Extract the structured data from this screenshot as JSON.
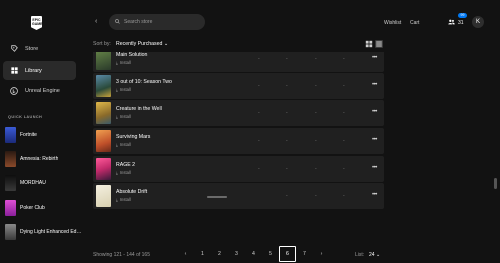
{
  "logo": {
    "text": "EPIC\nGAMES"
  },
  "sidebar": {
    "nav": [
      {
        "label": "Store",
        "icon": "tag-icon",
        "active": false
      },
      {
        "label": "Library",
        "icon": "grid-icon",
        "active": true
      },
      {
        "label": "Unreal Engine",
        "icon": "unreal-icon",
        "active": false
      }
    ],
    "quick_launch_title": "QUICK LAUNCH",
    "quick_launch": [
      {
        "label": "Fortnite",
        "color": "#3b5bd6"
      },
      {
        "label": "Amnesia: Rebirth",
        "color": "#6a3b2a"
      },
      {
        "label": "MORDHAU",
        "color": "#1c1c1c"
      },
      {
        "label": "Poker Club",
        "color": "#d63bd1"
      },
      {
        "label": "Dying Light Enhanced Edition",
        "color": "#6e6e6e"
      }
    ]
  },
  "topbar": {
    "search_placeholder": "Search store",
    "wishlist": "Wishlist",
    "cart": "Cart",
    "friends_count": "31",
    "friends_badge": "99",
    "avatar_initial": "K"
  },
  "sort": {
    "label": "Sort by:",
    "value": "Recently Purchased"
  },
  "rows": [
    {
      "title": "Main Solution",
      "install": "Install",
      "thumb_color": "#4a6a3a",
      "dashes": [
        "-",
        "-",
        "-",
        "-"
      ]
    },
    {
      "title": "3 out of 10: Season Two",
      "install": "Install",
      "thumb_color": "#3a6a8a",
      "dashes": [
        "-",
        "-",
        "-",
        "-"
      ]
    },
    {
      "title": "Creature in the Well",
      "install": "Install",
      "thumb_color": "#c7a23a",
      "dashes": [
        "-",
        "-",
        "-",
        "-"
      ]
    },
    {
      "title": "Surviving Mars",
      "install": "Install",
      "thumb_color": "#d8733a",
      "dashes": [
        "-",
        "-",
        "-",
        "-"
      ]
    },
    {
      "title": "RAGE 2",
      "install": "Install",
      "thumb_color": "#d94c8a",
      "dashes": [
        "-",
        "-",
        "-",
        "-"
      ]
    },
    {
      "title": "Absolute Drift",
      "install": "Install",
      "thumb_color": "#e6e2d0",
      "dashes": [
        "-",
        "-",
        "-"
      ],
      "progress": 1.0
    }
  ],
  "footer": {
    "count_text": "Showing 121 - 144 of 165",
    "pages": [
      "‹",
      "1",
      "2",
      "3",
      "4",
      "5",
      "6",
      "7",
      "›"
    ],
    "current_page": "6",
    "per_page_label": "List:",
    "per_page_value": "24"
  },
  "colors": {
    "accent": "#0078f2",
    "background": "#121212",
    "row": "#202020"
  }
}
